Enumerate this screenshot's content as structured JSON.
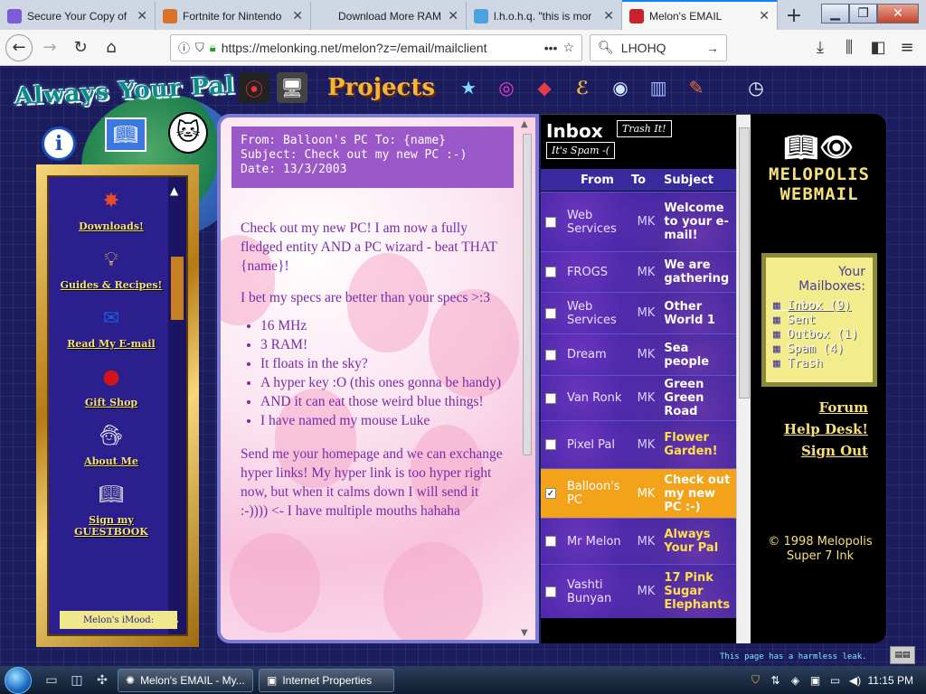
{
  "browser": {
    "tabs": [
      {
        "label": "Secure Your Copy of",
        "icon": "puzzle-icon",
        "color": "#7d5bd6"
      },
      {
        "label": "Fortnite for Nintendo",
        "icon": "fortnite-icon",
        "color": "#d9732b"
      },
      {
        "label": "Download More RAM!",
        "icon": "page-icon",
        "color": "#cfd6e4"
      },
      {
        "label": "l.h.o.h.q. \"this is mor",
        "icon": "lhohq-icon",
        "color": "#4aa3df"
      },
      {
        "label": "Melon's EMAIL",
        "icon": "melon-icon",
        "color": "#c8232c",
        "active": true
      }
    ],
    "new_tab": "+",
    "url": "https://melonking.net/melon?z=/email/mailclient",
    "search": "LHOHQ"
  },
  "site": {
    "logo": "Always Your Pal",
    "projects": "Projects",
    "menu": [
      {
        "label": "Downloads!",
        "icon": "downloads-icon",
        "color": "#e94a2a"
      },
      {
        "label": "Guides & Recipes!",
        "icon": "lightbulb-icon",
        "color": "#f6d24a"
      },
      {
        "label": "Read My E-mail",
        "icon": "mailbox-icon",
        "color": "#1f5be0"
      },
      {
        "label": "Gift Shop",
        "icon": "globe-icon",
        "color": "#d3141c"
      },
      {
        "label": "About Me",
        "icon": "wizard-icon",
        "color": "#ffffff"
      },
      {
        "label": "Sign my GUESTBOOK",
        "icon": "guestbook-icon",
        "color": "#e0e0e0"
      }
    ],
    "mood": "Melon's iMood:"
  },
  "message": {
    "header_line1": "From: Balloon's PC To: {name}",
    "header_line2": "Subject: Check out my new PC :-)",
    "header_line3": "Date: 13/3/2003",
    "p1": "Check out my new PC! I am now a fully fledged entity AND a PC wizard - beat THAT {name}!",
    "p2": "I bet my specs are better than your specs >:3",
    "bullets": [
      "16 MHz",
      "3 RAM!",
      "It floats in the sky?",
      "A hyper key :O (this ones gonna be handy)",
      "AND it can eat those weird blue things!",
      "I have named my mouse Luke"
    ],
    "p3": "Send me your homepage and we can exchange hyper links! My hyper link is too hyper right now, but when it calms down I will send it :-)))) <- I have multiple mouths hahaha"
  },
  "inbox": {
    "title": "Inbox",
    "trash_label": "Trash It!",
    "spam_label": "It's Spam -(",
    "col_from": "From",
    "col_to": "To",
    "col_subject": "Subject",
    "rows": [
      {
        "from": "Web Services",
        "to": "MK",
        "subject": "Welcome to your e-mail!",
        "checked": false
      },
      {
        "from": "FROGS",
        "to": "MK",
        "subject": "We are gathering",
        "checked": false
      },
      {
        "from": "Web Services",
        "to": "MK",
        "subject": "Other World 1",
        "checked": false
      },
      {
        "from": "Dream",
        "to": "MK",
        "subject": "Sea people",
        "checked": false
      },
      {
        "from": "Van Ronk",
        "to": "MK",
        "subject": "Green Green Road",
        "checked": false
      },
      {
        "from": "Pixel Pal",
        "to": "MK",
        "subject": "Flower Garden!",
        "checked": false,
        "highlight": true
      },
      {
        "from": "Balloon's PC",
        "to": "MK",
        "subject": "Check out my new PC :-)",
        "checked": true,
        "selected": true
      },
      {
        "from": "Mr Melon",
        "to": "MK",
        "subject": "Always Your Pal",
        "checked": false,
        "highlight": true
      },
      {
        "from": "Vashti Bunyan",
        "to": "MK",
        "subject": "17 Pink Sugar Elephants",
        "checked": false,
        "highlight": true
      }
    ]
  },
  "sidebar": {
    "logo_line1": "MELOPOLIS",
    "logo_line2": "WEBMAIL",
    "mailboxes_title": "Your Mailboxes:",
    "mailboxes": [
      {
        "label": "Inbox (9)",
        "current": true
      },
      {
        "label": "Sent"
      },
      {
        "label": "Outbox (1)"
      },
      {
        "label": "Spam (4)"
      },
      {
        "label": "Trash"
      }
    ],
    "forum": "Forum",
    "help": "Help Desk!",
    "signout": "Sign Out",
    "copyright": "© 1998 Melopolis Super 7 Ink"
  },
  "footer": {
    "leak": "This page has a harmless leak."
  },
  "taskbar": {
    "tasks": [
      "Melon's EMAIL - My...",
      "Internet Properties"
    ],
    "clock": "11:15 PM"
  }
}
